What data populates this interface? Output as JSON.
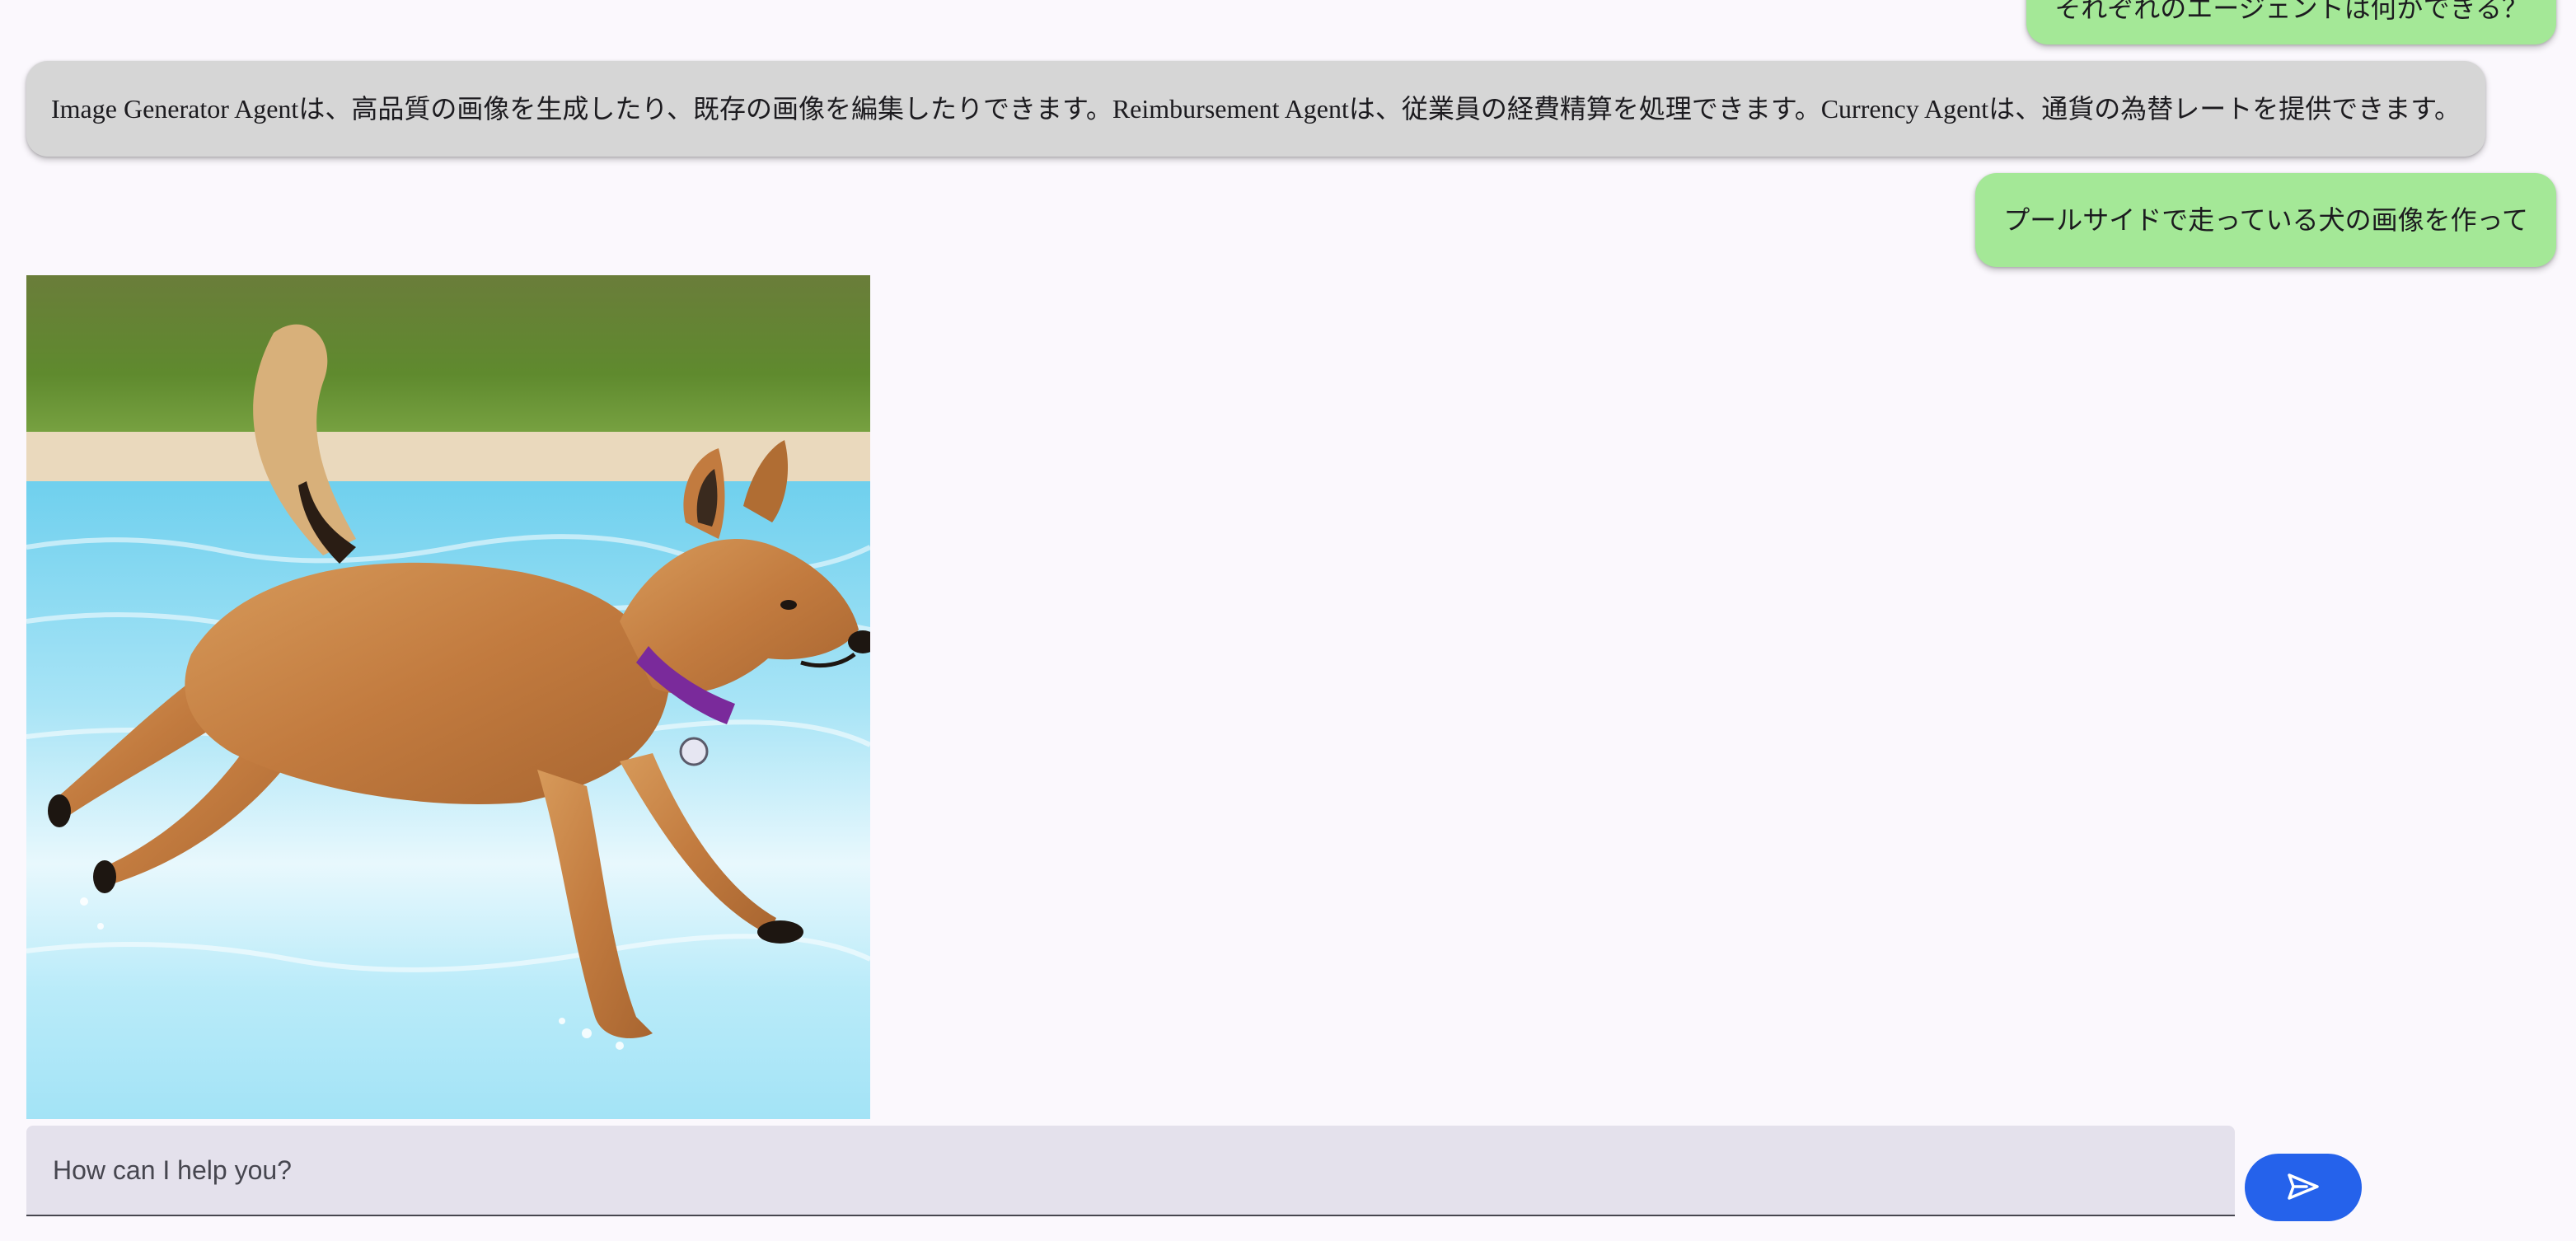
{
  "messages": {
    "user_1": "それぞれのエージェントは何ができる？",
    "agent_1": "Image Generator Agentは、高品質の画像を生成したり、既存の画像を編集したりできます。Reimbursement Agentは、従業員の経費精算を処理できます。Currency Agentは、通貨の為替レートを提供できます。",
    "user_2": "プールサイドで走っている犬の画像を作って"
  },
  "composer": {
    "placeholder": "How can I help you?",
    "value": ""
  },
  "icons": {
    "send": "send-icon"
  },
  "colors": {
    "background": "#fbf8fd",
    "user_bubble": "#a4e897",
    "agent_bubble": "#d6d6d6",
    "composer_bg": "#e4e1ec",
    "send_button": "#2562eb"
  }
}
